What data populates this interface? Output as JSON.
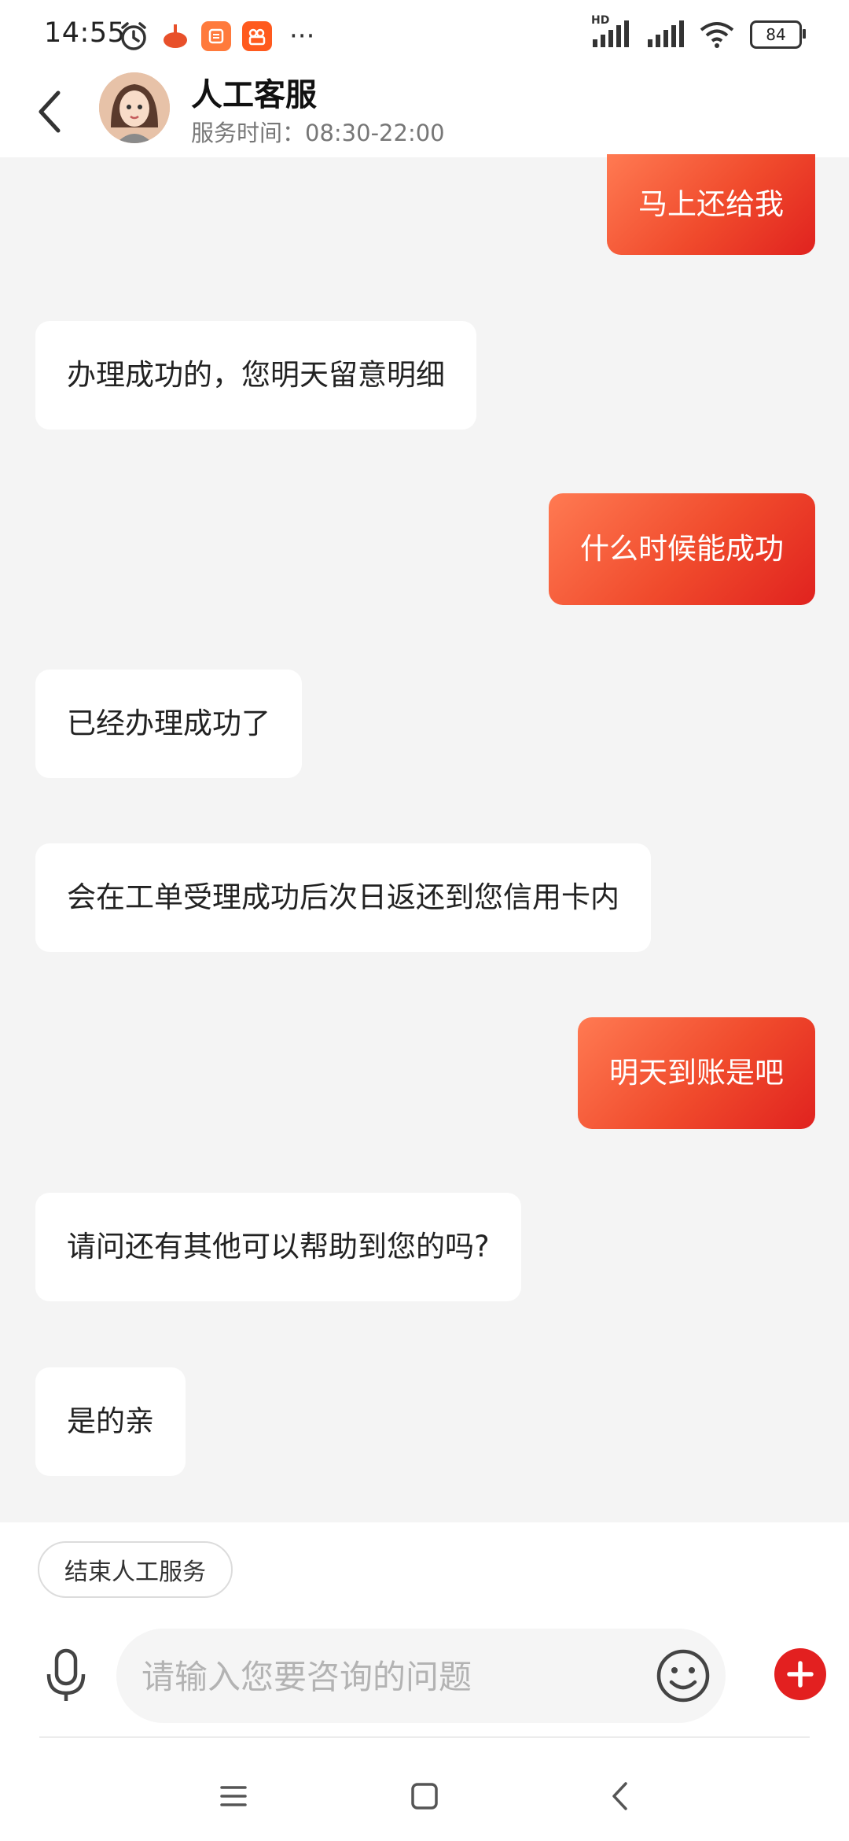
{
  "status_bar": {
    "time": "14:55",
    "network_label": "HD",
    "battery": "84",
    "icons": [
      "alarm-icon",
      "app-icon-1",
      "app-icon-2",
      "app-icon-3",
      "more-dots-icon",
      "signal-icon",
      "wifi-icon",
      "battery-icon"
    ]
  },
  "header": {
    "title": "人工客服",
    "subtitle": "服务时间：08:30-22:00"
  },
  "messages": [
    {
      "role": "user",
      "text": "马上还给我"
    },
    {
      "role": "agent",
      "text": "办理成功的，您明天留意明细"
    },
    {
      "role": "user",
      "text": "什么时候能成功"
    },
    {
      "role": "agent",
      "text": "已经办理成功了"
    },
    {
      "role": "agent",
      "text": "会在工单受理成功后次日返还到您信用卡内"
    },
    {
      "role": "user",
      "text": "明天到账是吧"
    },
    {
      "role": "agent",
      "text": "请问还有其他可以帮助到您的吗?"
    },
    {
      "role": "agent",
      "text": "是的亲"
    }
  ],
  "bottom": {
    "end_service_label": "结束人工服务",
    "input_placeholder": "请输入您要咨询的问题"
  },
  "colors": {
    "accent_red": "#e32020",
    "user_bubble_start": "#ff7a52",
    "user_bubble_end": "#e0221f"
  }
}
